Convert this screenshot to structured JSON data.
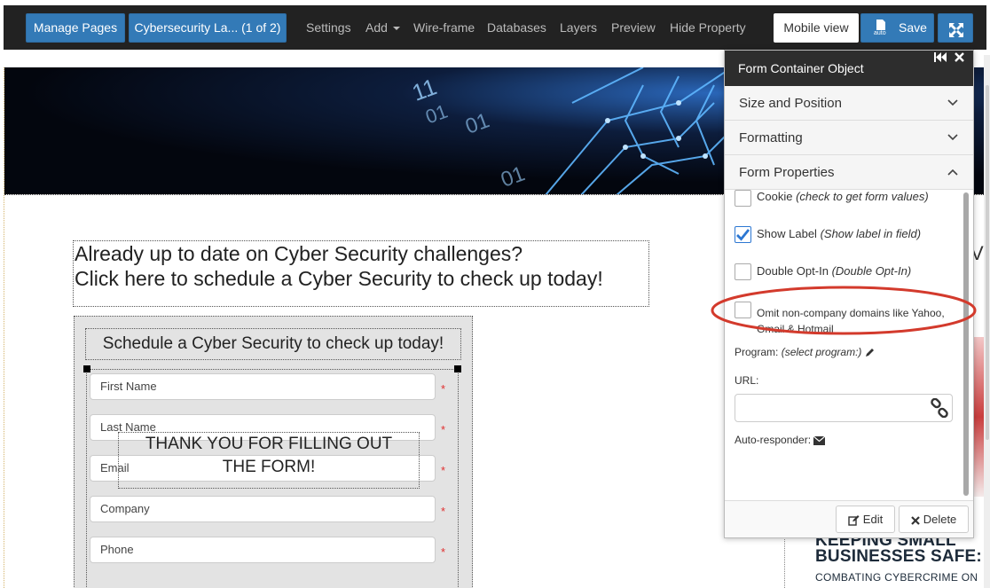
{
  "toolbar": {
    "manage_pages": "Manage Pages",
    "current_page": "Cybersecurity La... (1 of 2)",
    "nav": [
      "Settings",
      "Add",
      "Wire-frame",
      "Databases",
      "Layers",
      "Preview",
      "Hide Property"
    ],
    "mobile_view": "Mobile view",
    "save": "Save",
    "save_icon_caption": "auto",
    "accent_color": "#337ab7",
    "bar_color": "#222222"
  },
  "page": {
    "headline_lines": [
      "Already up to date on Cyber Security challenges?",
      "Click here to schedule a Cyber Security to check up today!"
    ],
    "form": {
      "title": "Schedule a Cyber Security to check up today!",
      "fields": [
        {
          "placeholder": "First Name",
          "required_mark": "*"
        },
        {
          "placeholder": "Last Name",
          "required_mark": "*"
        },
        {
          "placeholder": "Email",
          "required_mark": "*"
        },
        {
          "placeholder": "Company",
          "required_mark": "*"
        },
        {
          "placeholder": "Phone",
          "required_mark": "*"
        }
      ],
      "thank_you_lines": [
        "THANK YOU FOR FILLING OUT",
        "THE FORM!"
      ]
    },
    "right_edge_letter": "V",
    "side_article": {
      "heading_lines": [
        "KEEPING SMALL",
        "BUSINESSES SAFE:"
      ],
      "subheading": "COMBATING CYBERCRIME ON"
    },
    "banner_digits": [
      "11",
      "01",
      "01",
      "01"
    ]
  },
  "panel": {
    "title": "Form Container Object",
    "sections": [
      {
        "label": "Size and Position",
        "expanded": false
      },
      {
        "label": "Formatting",
        "expanded": false
      },
      {
        "label": "Form Properties",
        "expanded": true
      }
    ],
    "properties": {
      "cookie": {
        "label": "Cookie",
        "hint": "(check to get form values)",
        "checked": false
      },
      "show_label": {
        "label": "Show Label",
        "hint": "(Show label in field)",
        "checked": true
      },
      "double_optin": {
        "label": "Double Opt-In",
        "hint": "(Double Opt-In)",
        "checked": false
      },
      "omit_domains": {
        "label": "Omit non-company domains like Yahoo, Gmail & Hotmail",
        "checked": false
      },
      "program_label": "Program:",
      "program_value": "(select program:)",
      "url_label": "URL:",
      "url_value": "",
      "auto_responder_label": "Auto-responder:"
    },
    "footer": {
      "edit": "Edit",
      "delete": "Delete"
    },
    "highlight_color": "#d33a2c"
  }
}
